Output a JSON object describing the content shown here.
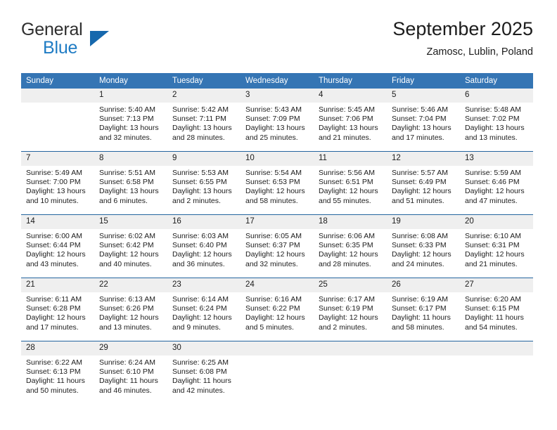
{
  "brand": {
    "name_part1": "General",
    "name_part2": "Blue",
    "triangle_color": "#1668ad",
    "blue_color": "#1f7cc4"
  },
  "header": {
    "title": "September 2025",
    "subtitle": "Zamosc, Lublin, Poland"
  },
  "theme": {
    "header_bg": "#3575b4",
    "row_divider": "#24659f",
    "daynum_bg": "#efefef",
    "text": "#1c1c1c"
  },
  "weekdays": [
    "Sunday",
    "Monday",
    "Tuesday",
    "Wednesday",
    "Thursday",
    "Friday",
    "Saturday"
  ],
  "labels": {
    "sunrise_prefix": "Sunrise:",
    "sunset_prefix": "Sunset:",
    "daylight_prefix": "Daylight:"
  },
  "weeks": [
    [
      {
        "day": "",
        "empty": true
      },
      {
        "day": "1",
        "sunrise": "Sunrise: 5:40 AM",
        "sunset": "Sunset: 7:13 PM",
        "daylight1": "Daylight: 13 hours",
        "daylight2": "and 32 minutes."
      },
      {
        "day": "2",
        "sunrise": "Sunrise: 5:42 AM",
        "sunset": "Sunset: 7:11 PM",
        "daylight1": "Daylight: 13 hours",
        "daylight2": "and 28 minutes."
      },
      {
        "day": "3",
        "sunrise": "Sunrise: 5:43 AM",
        "sunset": "Sunset: 7:09 PM",
        "daylight1": "Daylight: 13 hours",
        "daylight2": "and 25 minutes."
      },
      {
        "day": "4",
        "sunrise": "Sunrise: 5:45 AM",
        "sunset": "Sunset: 7:06 PM",
        "daylight1": "Daylight: 13 hours",
        "daylight2": "and 21 minutes."
      },
      {
        "day": "5",
        "sunrise": "Sunrise: 5:46 AM",
        "sunset": "Sunset: 7:04 PM",
        "daylight1": "Daylight: 13 hours",
        "daylight2": "and 17 minutes."
      },
      {
        "day": "6",
        "sunrise": "Sunrise: 5:48 AM",
        "sunset": "Sunset: 7:02 PM",
        "daylight1": "Daylight: 13 hours",
        "daylight2": "and 13 minutes."
      }
    ],
    [
      {
        "day": "7",
        "sunrise": "Sunrise: 5:49 AM",
        "sunset": "Sunset: 7:00 PM",
        "daylight1": "Daylight: 13 hours",
        "daylight2": "and 10 minutes."
      },
      {
        "day": "8",
        "sunrise": "Sunrise: 5:51 AM",
        "sunset": "Sunset: 6:58 PM",
        "daylight1": "Daylight: 13 hours",
        "daylight2": "and 6 minutes."
      },
      {
        "day": "9",
        "sunrise": "Sunrise: 5:53 AM",
        "sunset": "Sunset: 6:55 PM",
        "daylight1": "Daylight: 13 hours",
        "daylight2": "and 2 minutes."
      },
      {
        "day": "10",
        "sunrise": "Sunrise: 5:54 AM",
        "sunset": "Sunset: 6:53 PM",
        "daylight1": "Daylight: 12 hours",
        "daylight2": "and 58 minutes."
      },
      {
        "day": "11",
        "sunrise": "Sunrise: 5:56 AM",
        "sunset": "Sunset: 6:51 PM",
        "daylight1": "Daylight: 12 hours",
        "daylight2": "and 55 minutes."
      },
      {
        "day": "12",
        "sunrise": "Sunrise: 5:57 AM",
        "sunset": "Sunset: 6:49 PM",
        "daylight1": "Daylight: 12 hours",
        "daylight2": "and 51 minutes."
      },
      {
        "day": "13",
        "sunrise": "Sunrise: 5:59 AM",
        "sunset": "Sunset: 6:46 PM",
        "daylight1": "Daylight: 12 hours",
        "daylight2": "and 47 minutes."
      }
    ],
    [
      {
        "day": "14",
        "sunrise": "Sunrise: 6:00 AM",
        "sunset": "Sunset: 6:44 PM",
        "daylight1": "Daylight: 12 hours",
        "daylight2": "and 43 minutes."
      },
      {
        "day": "15",
        "sunrise": "Sunrise: 6:02 AM",
        "sunset": "Sunset: 6:42 PM",
        "daylight1": "Daylight: 12 hours",
        "daylight2": "and 40 minutes."
      },
      {
        "day": "16",
        "sunrise": "Sunrise: 6:03 AM",
        "sunset": "Sunset: 6:40 PM",
        "daylight1": "Daylight: 12 hours",
        "daylight2": "and 36 minutes."
      },
      {
        "day": "17",
        "sunrise": "Sunrise: 6:05 AM",
        "sunset": "Sunset: 6:37 PM",
        "daylight1": "Daylight: 12 hours",
        "daylight2": "and 32 minutes."
      },
      {
        "day": "18",
        "sunrise": "Sunrise: 6:06 AM",
        "sunset": "Sunset: 6:35 PM",
        "daylight1": "Daylight: 12 hours",
        "daylight2": "and 28 minutes."
      },
      {
        "day": "19",
        "sunrise": "Sunrise: 6:08 AM",
        "sunset": "Sunset: 6:33 PM",
        "daylight1": "Daylight: 12 hours",
        "daylight2": "and 24 minutes."
      },
      {
        "day": "20",
        "sunrise": "Sunrise: 6:10 AM",
        "sunset": "Sunset: 6:31 PM",
        "daylight1": "Daylight: 12 hours",
        "daylight2": "and 21 minutes."
      }
    ],
    [
      {
        "day": "21",
        "sunrise": "Sunrise: 6:11 AM",
        "sunset": "Sunset: 6:28 PM",
        "daylight1": "Daylight: 12 hours",
        "daylight2": "and 17 minutes."
      },
      {
        "day": "22",
        "sunrise": "Sunrise: 6:13 AM",
        "sunset": "Sunset: 6:26 PM",
        "daylight1": "Daylight: 12 hours",
        "daylight2": "and 13 minutes."
      },
      {
        "day": "23",
        "sunrise": "Sunrise: 6:14 AM",
        "sunset": "Sunset: 6:24 PM",
        "daylight1": "Daylight: 12 hours",
        "daylight2": "and 9 minutes."
      },
      {
        "day": "24",
        "sunrise": "Sunrise: 6:16 AM",
        "sunset": "Sunset: 6:22 PM",
        "daylight1": "Daylight: 12 hours",
        "daylight2": "and 5 minutes."
      },
      {
        "day": "25",
        "sunrise": "Sunrise: 6:17 AM",
        "sunset": "Sunset: 6:19 PM",
        "daylight1": "Daylight: 12 hours",
        "daylight2": "and 2 minutes."
      },
      {
        "day": "26",
        "sunrise": "Sunrise: 6:19 AM",
        "sunset": "Sunset: 6:17 PM",
        "daylight1": "Daylight: 11 hours",
        "daylight2": "and 58 minutes."
      },
      {
        "day": "27",
        "sunrise": "Sunrise: 6:20 AM",
        "sunset": "Sunset: 6:15 PM",
        "daylight1": "Daylight: 11 hours",
        "daylight2": "and 54 minutes."
      }
    ],
    [
      {
        "day": "28",
        "sunrise": "Sunrise: 6:22 AM",
        "sunset": "Sunset: 6:13 PM",
        "daylight1": "Daylight: 11 hours",
        "daylight2": "and 50 minutes."
      },
      {
        "day": "29",
        "sunrise": "Sunrise: 6:24 AM",
        "sunset": "Sunset: 6:10 PM",
        "daylight1": "Daylight: 11 hours",
        "daylight2": "and 46 minutes."
      },
      {
        "day": "30",
        "sunrise": "Sunrise: 6:25 AM",
        "sunset": "Sunset: 6:08 PM",
        "daylight1": "Daylight: 11 hours",
        "daylight2": "and 42 minutes."
      },
      {
        "day": "",
        "empty": true
      },
      {
        "day": "",
        "empty": true
      },
      {
        "day": "",
        "empty": true
      },
      {
        "day": "",
        "empty": true
      }
    ]
  ]
}
